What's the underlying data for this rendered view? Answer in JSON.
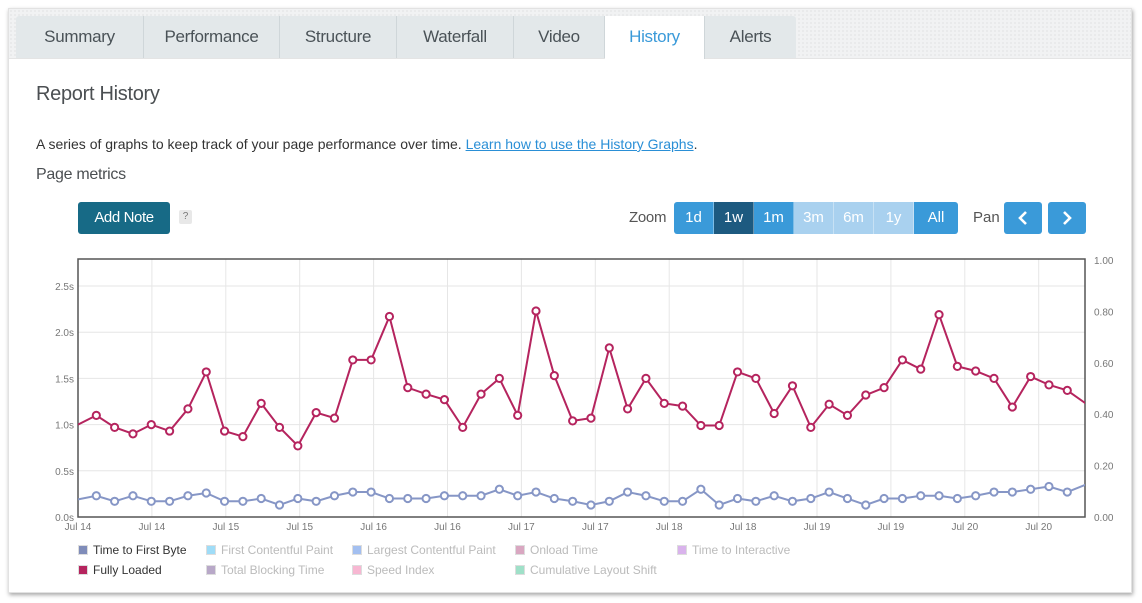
{
  "tabs": [
    {
      "label": "Summary",
      "active": false
    },
    {
      "label": "Performance",
      "active": false
    },
    {
      "label": "Structure",
      "active": false
    },
    {
      "label": "Waterfall",
      "active": false
    },
    {
      "label": "Video",
      "active": false
    },
    {
      "label": "History",
      "active": true
    },
    {
      "label": "Alerts",
      "active": false
    }
  ],
  "page": {
    "title": "Report History",
    "description": "A series of graphs to keep track of your page performance over time. ",
    "link_text": "Learn how to use the History Graphs",
    "description_end": ".",
    "section_title": "Page metrics"
  },
  "toolbar": {
    "add_note_label": "Add Note",
    "help_label": "?",
    "zoom_label": "Zoom",
    "zoom_options": [
      {
        "label": "1d",
        "state": "enabled"
      },
      {
        "label": "1w",
        "state": "selected"
      },
      {
        "label": "1m",
        "state": "enabled"
      },
      {
        "label": "3m",
        "state": "disabled"
      },
      {
        "label": "6m",
        "state": "disabled"
      },
      {
        "label": "1y",
        "state": "disabled"
      },
      {
        "label": "All",
        "state": "enabled"
      }
    ],
    "pan_label": "Pan",
    "pan_left_icon": "chevron-left-icon",
    "pan_right_icon": "chevron-right-icon"
  },
  "chart_data": {
    "type": "line",
    "title": "",
    "xlabel": "",
    "ylabel": "",
    "ylim": [
      0,
      2.75
    ],
    "y_ticks": [
      "0.0s",
      "0.5s",
      "1.0s",
      "1.5s",
      "2.0s",
      "2.5s"
    ],
    "y_tick_values": [
      0,
      0.5,
      1.0,
      1.5,
      2.0,
      2.5
    ],
    "y2lim": [
      0,
      1.0
    ],
    "y2_ticks": [
      "0.00",
      "0.20",
      "0.40",
      "0.60",
      "0.80",
      "1.00"
    ],
    "y2_tick_values": [
      0,
      0.2,
      0.4,
      0.6,
      0.8,
      1.0
    ],
    "x_ticks": [
      "Jul 14",
      "Jul 14",
      "Jul 15",
      "Jul 15",
      "Jul 16",
      "Jul 16",
      "Jul 17",
      "Jul 17",
      "Jul 18",
      "Jul 18",
      "Jul 19",
      "Jul 19",
      "Jul 20",
      "Jul 20"
    ],
    "grid": true,
    "legend_position": "bottom",
    "series": [
      {
        "name": "Fully Loaded",
        "color": "#b5245e",
        "values": [
          1.0,
          1.1,
          0.97,
          0.9,
          1.0,
          0.93,
          1.17,
          1.57,
          0.93,
          0.87,
          1.23,
          0.97,
          0.77,
          1.13,
          1.07,
          1.7,
          1.7,
          2.17,
          1.4,
          1.33,
          1.27,
          0.97,
          1.33,
          1.5,
          1.1,
          2.23,
          1.53,
          1.04,
          1.07,
          1.83,
          1.17,
          1.5,
          1.23,
          1.2,
          0.99,
          0.99,
          1.57,
          1.5,
          1.12,
          1.42,
          0.97,
          1.22,
          1.1,
          1.32,
          1.4,
          1.7,
          1.6,
          2.19,
          1.63,
          1.58,
          1.5,
          1.19,
          1.52,
          1.43,
          1.37,
          1.23
        ]
      },
      {
        "name": "Time to First Byte",
        "color": "#8696c6",
        "values": [
          0.19,
          0.23,
          0.17,
          0.23,
          0.17,
          0.17,
          0.23,
          0.26,
          0.17,
          0.17,
          0.2,
          0.13,
          0.2,
          0.17,
          0.23,
          0.27,
          0.27,
          0.2,
          0.2,
          0.2,
          0.23,
          0.23,
          0.23,
          0.3,
          0.23,
          0.27,
          0.2,
          0.17,
          0.13,
          0.17,
          0.27,
          0.23,
          0.17,
          0.17,
          0.3,
          0.13,
          0.2,
          0.17,
          0.23,
          0.17,
          0.2,
          0.27,
          0.2,
          0.13,
          0.2,
          0.2,
          0.23,
          0.23,
          0.2,
          0.23,
          0.27,
          0.27,
          0.3,
          0.33,
          0.27,
          0.35
        ]
      }
    ],
    "legend": [
      {
        "name": "Time to First Byte",
        "color": "#7f8cb9",
        "enabled": true
      },
      {
        "name": "First Contentful Paint",
        "color": "#9fdcf7",
        "enabled": false
      },
      {
        "name": "Largest Contentful Paint",
        "color": "#a3bff0",
        "enabled": false
      },
      {
        "name": "Onload Time",
        "color": "#d9a7c1",
        "enabled": false
      },
      {
        "name": "Time to Interactive",
        "color": "#d9b3ec",
        "enabled": false
      },
      {
        "name": "Fully Loaded",
        "color": "#b5245e",
        "enabled": true
      },
      {
        "name": "Total Blocking Time",
        "color": "#b8a8c8",
        "enabled": false
      },
      {
        "name": "Speed Index",
        "color": "#f7b7d2",
        "enabled": false
      },
      {
        "name": "Cumulative Layout Shift",
        "color": "#9fe0c8",
        "enabled": false
      }
    ]
  }
}
